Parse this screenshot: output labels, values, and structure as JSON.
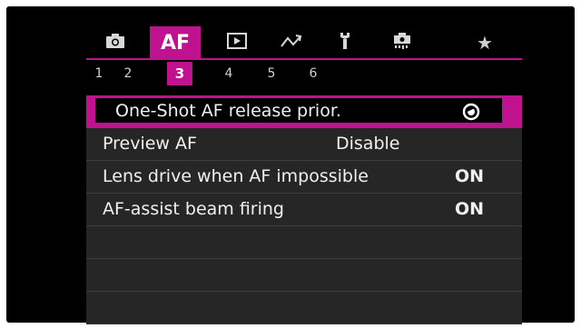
{
  "tabs": [
    {
      "icon": "camera-icon",
      "label": ""
    },
    {
      "icon": "",
      "label": "AF"
    },
    {
      "icon": "playback-icon",
      "label": ""
    },
    {
      "icon": "wireless-icon",
      "label": ""
    },
    {
      "icon": "wrench-icon",
      "label": ""
    },
    {
      "icon": "custom-functions-icon",
      "label": ""
    },
    {
      "icon": "star-icon",
      "label": "★"
    }
  ],
  "pages": [
    "1",
    "2",
    "3",
    "4",
    "5",
    "6"
  ],
  "active_page": "3",
  "menu": {
    "items": [
      {
        "label": "One-Shot AF release prior.",
        "value": "",
        "value_icon": "focus-priority-icon"
      },
      {
        "label": "Preview AF",
        "value": "Disable"
      },
      {
        "label": "Lens drive when AF impossible",
        "value": "ON"
      },
      {
        "label": "AF-assist beam firing",
        "value": "ON"
      }
    ]
  },
  "colors": {
    "accent": "#c0128e",
    "background": "#000000",
    "row_background": "#262626"
  }
}
